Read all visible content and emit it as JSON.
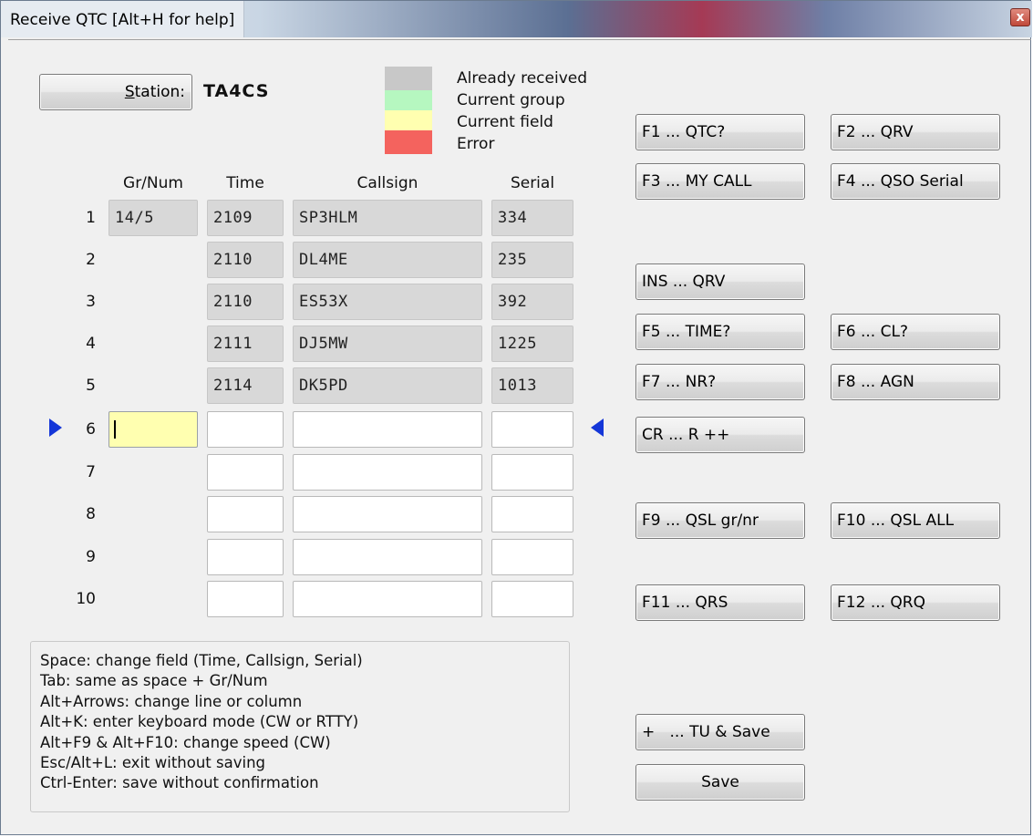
{
  "window": {
    "title": "Receive QTC [Alt+H for help]",
    "close_glyph": "x"
  },
  "station": {
    "button_label": "Station:",
    "callsign": "TA4CS"
  },
  "legend": [
    {
      "label": "Already received",
      "color": "#c8c8c8"
    },
    {
      "label": "Current group",
      "color": "#b6f7c0"
    },
    {
      "label": "Current field",
      "color": "#ffffb0"
    },
    {
      "label": "Error",
      "color": "#f4635e"
    }
  ],
  "table": {
    "headers": {
      "grnum": "Gr/Num",
      "time": "Time",
      "callsign": "Callsign",
      "serial": "Serial"
    },
    "rows": [
      {
        "num": "1",
        "grnum": "14/5",
        "time": "2109",
        "callsign": "SP3HLM",
        "serial": "334",
        "state": "received"
      },
      {
        "num": "2",
        "grnum": "",
        "time": "2110",
        "callsign": "DL4ME",
        "serial": "235",
        "state": "received"
      },
      {
        "num": "3",
        "grnum": "",
        "time": "2110",
        "callsign": "ES53X",
        "serial": "392",
        "state": "received"
      },
      {
        "num": "4",
        "grnum": "",
        "time": "2111",
        "callsign": "DJ5MW",
        "serial": "1225",
        "state": "received"
      },
      {
        "num": "5",
        "grnum": "",
        "time": "2114",
        "callsign": "DK5PD",
        "serial": "1013",
        "state": "received"
      },
      {
        "num": "6",
        "grnum": "",
        "time": "",
        "callsign": "",
        "serial": "",
        "state": "current"
      },
      {
        "num": "7",
        "grnum": "",
        "time": "",
        "callsign": "",
        "serial": "",
        "state": "empty"
      },
      {
        "num": "8",
        "grnum": "",
        "time": "",
        "callsign": "",
        "serial": "",
        "state": "empty"
      },
      {
        "num": "9",
        "grnum": "",
        "time": "",
        "callsign": "",
        "serial": "",
        "state": "empty"
      },
      {
        "num": "10",
        "grnum": "",
        "time": "",
        "callsign": "",
        "serial": "",
        "state": "empty"
      }
    ]
  },
  "buttons": {
    "f1": "F1 ... QTC?",
    "f2": "F2 ... QRV",
    "f3": "F3 ... MY CALL",
    "f4": "F4 ... QSO Serial",
    "ins": "INS ... QRV",
    "f5": "F5 ... TIME?",
    "f6": "F6 ... CL?",
    "f7": "F7 ... NR?",
    "f8": "F8 ... AGN",
    "cr": "CR ... R ++",
    "f9": "F9 ... QSL gr/nr",
    "f10": "F10 ... QSL ALL",
    "f11": "F11 ... QRS",
    "f12": "F12 ... QRQ",
    "plus": "+   ... TU & Save",
    "save": "Save"
  },
  "help_lines": [
    "Space: change field (Time, Callsign, Serial)",
    "Tab: same as space + Gr/Num",
    "Alt+Arrows: change line or column",
    "Alt+K: enter keyboard mode (CW or RTTY)",
    "Alt+F9 & Alt+F10: change speed (CW)",
    "Esc/Alt+L: exit without saving",
    "Ctrl-Enter: save without confirmation"
  ],
  "colors": {
    "received": "#d8d8d8",
    "current_field": "#ffffb0",
    "row_marker": "#1436d8"
  }
}
